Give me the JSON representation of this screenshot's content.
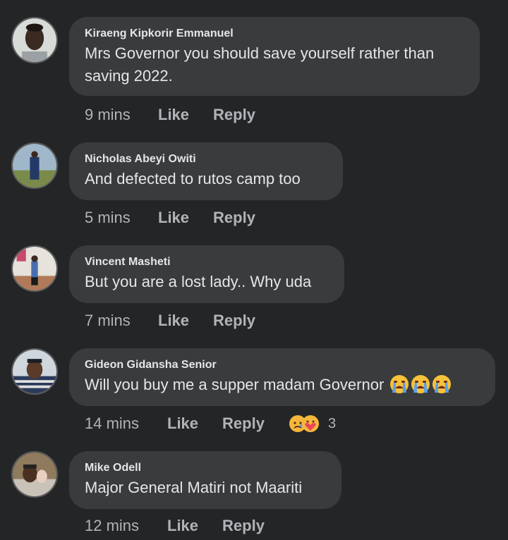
{
  "comments": [
    {
      "author": "Kiraeng Kipkorir Emmanuel",
      "text": "Mrs Governor you should save yourself rather than saving 2022.",
      "time": "9 mins",
      "like_label": "Like",
      "reply_label": "Reply"
    },
    {
      "author": "Nicholas Abeyi Owiti",
      "text": "And defected to rutos camp too",
      "time": "5 mins",
      "like_label": "Like",
      "reply_label": "Reply"
    },
    {
      "author": "Vincent Masheti",
      "text": "But you are a lost lady.. Why uda",
      "time": "7 mins",
      "like_label": "Like",
      "reply_label": "Reply"
    },
    {
      "author": "Gideon Gidansha Senior",
      "text": "Will you buy me a supper madam Governor",
      "emoji": [
        "crying-face",
        "crying-face",
        "crying-face"
      ],
      "time": "14 mins",
      "like_label": "Like",
      "reply_label": "Reply",
      "reactions": [
        "sad-reaction",
        "care-reaction"
      ],
      "reaction_count": "3"
    },
    {
      "author": "Mike Odell",
      "text": "Major General Matiri not Maariti",
      "time": "12 mins",
      "like_label": "Like",
      "reply_label": "Reply"
    }
  ],
  "colors": {
    "background": "#242526",
    "bubble": "#3a3b3c",
    "text": "#e4e6eb",
    "secondary_text": "#b0b3b8"
  }
}
